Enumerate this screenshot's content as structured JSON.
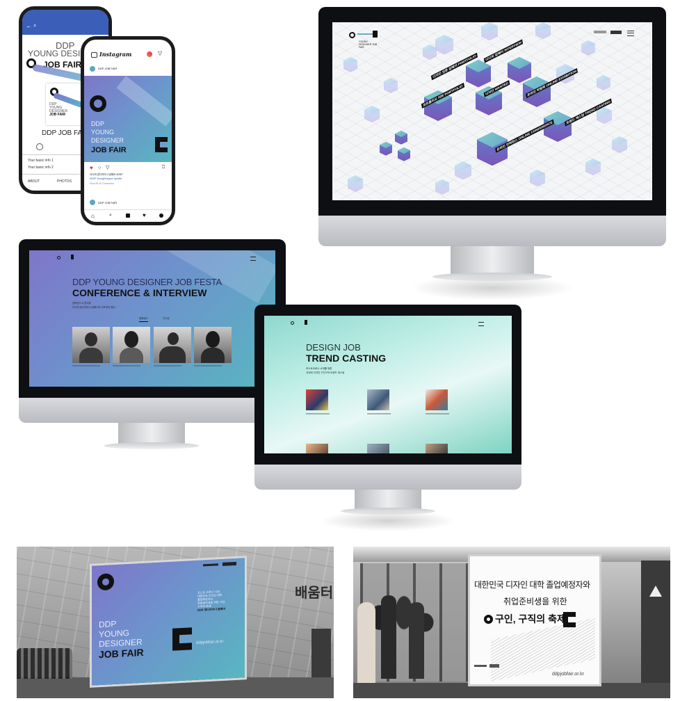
{
  "phone1": {
    "logo_lines": [
      "DDP",
      "YOUNG DESIGNER",
      "JOB FAIR"
    ],
    "page_name": "DDP JOB FAIR",
    "info": [
      "Your basic info 1",
      "Your basic info 2"
    ],
    "tabs": [
      "ABOUT",
      "PHOTOS"
    ]
  },
  "phone2": {
    "app": "Instagram",
    "account": "DDP JOB FAIR",
    "logo_lines": [
      "DDP",
      "YOUNG",
      "DESIGNER",
      "JOB FAIR"
    ],
    "caption_lines": [
      "디디피 영디자이너 잡페어 #DDP",
      "#DDP YoungDesigner #jobfair"
    ],
    "comments": "View All 16 Comments"
  },
  "monitor1": {
    "logo": "YOUNG DESIGNER JOB FAIR",
    "tags": [
      "디자인 전문 잡페어 PORTFOLIO",
      "디디피 잡페어 INTERVIEW",
      "포트폴리오 리뷰 PORTFOLIO",
      "디자인 WANTED",
      "온라인 박람회 ONLINE EXHIBITION",
      "트렌드 캐스팅 TREND CASTING",
      "온라인 컨퍼런스 ONLINE CONFERENCE"
    ]
  },
  "monitor2": {
    "title_line1": "DDP YOUNG DESIGNER JOB FESTA",
    "title_line2": "CONFERENCE & INTERVIEW",
    "sub": [
      "컨퍼런스 & 인터뷰",
      "디디피 영디자이너 잡페스타 오프라인 행사"
    ],
    "tabs": [
      "컨퍼런스",
      "인터뷰"
    ]
  },
  "monitor3": {
    "title_line1": "DESIGN JOB",
    "title_line2": "TREND CASTING",
    "sub": [
      "포스트코로나 시대를 위한",
      "국내외 디자인 구인구직 트렌드 캐스팅"
    ]
  },
  "billboard1": {
    "lines": [
      "DDP",
      "YOUNG",
      "DESIGNER"
    ],
    "bold": "JOB FAIR",
    "url": "ddpjobfair.or.kr",
    "building_sign": "배움터",
    "copy": [
      "포스트 코로나 시대",
      "대한민국 디자인 대학",
      "졸업예정자와",
      "취업준비생을 위한 구인,",
      "구직의 축제",
      "DDP 영디자이너 잡페어"
    ]
  },
  "billboard2": {
    "line1": "대한민국 디자인 대학 졸업예정자와",
    "line2": "취업준비생을 위한",
    "bold": "구인, 구직의 축제",
    "url": "ddpjobfair.or.kr"
  },
  "colors": {
    "violet": "#7e76c9",
    "teal": "#58b7c0",
    "mint": "#8ed8cf",
    "black": "#111111"
  }
}
